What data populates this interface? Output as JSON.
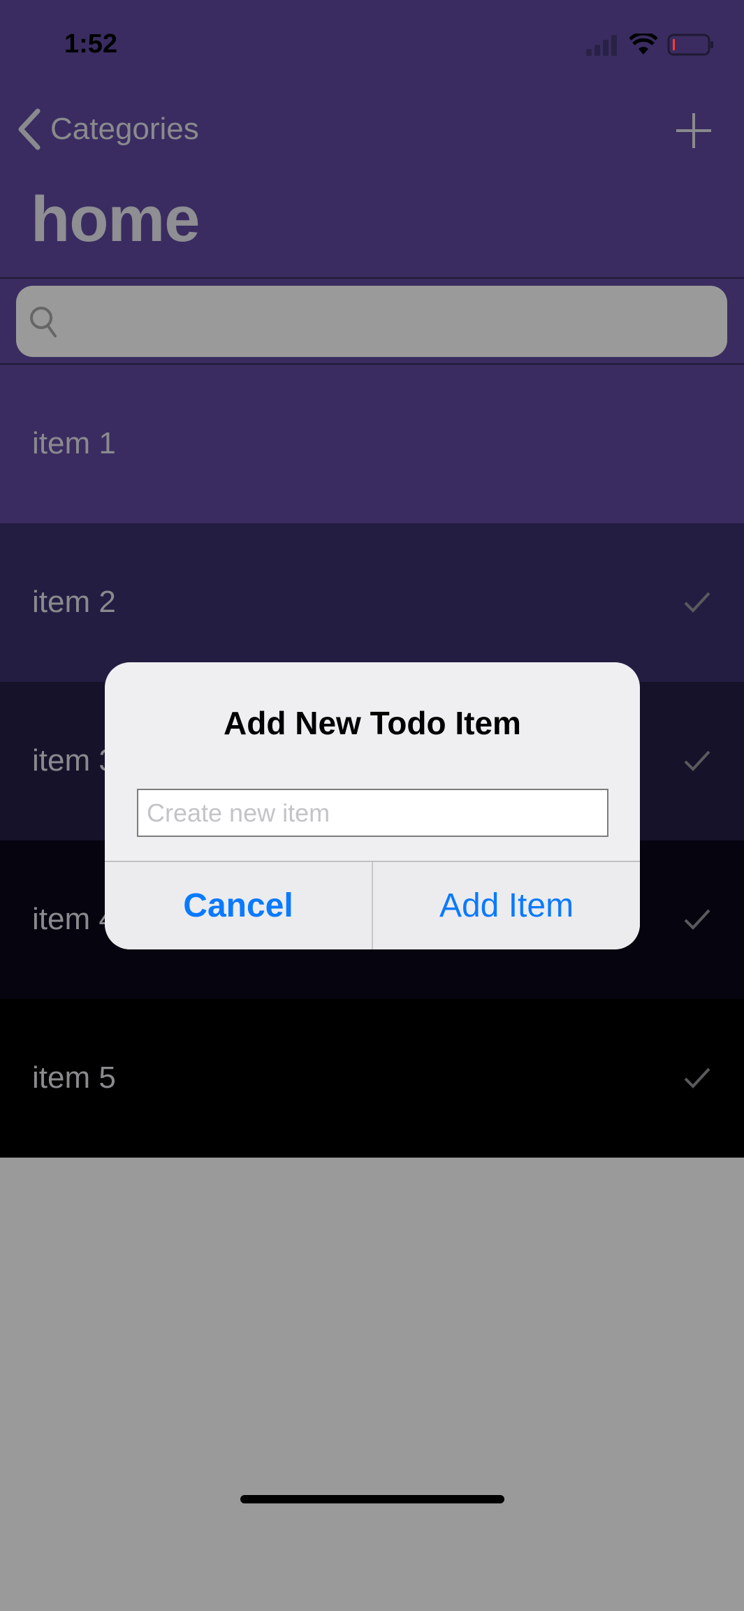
{
  "status_bar": {
    "time": "1:52"
  },
  "nav": {
    "back_label": "Categories",
    "title": "home"
  },
  "search": {
    "placeholder": ""
  },
  "items": [
    {
      "label": "item 1",
      "done": false,
      "color": "#3a2c60"
    },
    {
      "label": "item 2",
      "done": true,
      "color": "#241d42"
    },
    {
      "label": "item 3",
      "done": true,
      "color": "#16122a"
    },
    {
      "label": "item 4",
      "done": true,
      "color": "#06050f"
    },
    {
      "label": "item 5",
      "done": true,
      "color": "#000000"
    }
  ],
  "dialog": {
    "title": "Add New Todo Item",
    "input_placeholder": "Create new item",
    "input_value": "",
    "cancel_label": "Cancel",
    "confirm_label": "Add Item"
  },
  "colors": {
    "accent": "#0a7aff",
    "nav_bg": "#3a2c60"
  }
}
